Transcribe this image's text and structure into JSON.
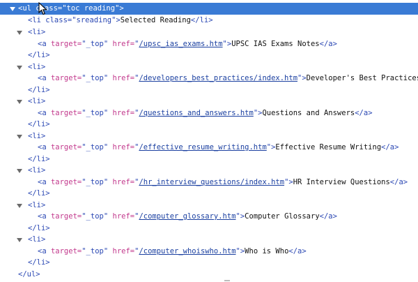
{
  "root": {
    "open": "<ul class=\"toc reading\">",
    "close": "</ul>"
  },
  "selected_reading": {
    "open": "<li class=",
    "class_value": "\"sreading\"",
    "gt": ">",
    "text": "Selected Reading",
    "close": "</li>"
  },
  "items": [
    {
      "href": "/upsc_ias_exams.htm",
      "text": "UPSC IAS Exams Notes"
    },
    {
      "href": "/developers_best_practices/index.htm",
      "text": "Developer's Best Practices"
    },
    {
      "href": "/questions_and_answers.htm",
      "text": "Questions and Answers"
    },
    {
      "href": "/effective_resume_writing.htm",
      "text": "Effective Resume Writing"
    },
    {
      "href": "/hr_interview_questions/index.htm",
      "text": "HR Interview Questions"
    },
    {
      "href": "/computer_glossary.htm",
      "text": "Computer Glossary"
    },
    {
      "href": "/computer_whoiswho.htm",
      "text": "Who is Who"
    }
  ],
  "tokens": {
    "li_open": "<li>",
    "li_close": "</li>",
    "a_open": "<a ",
    "target_attr": "target=",
    "target_val": "\"_top\"",
    "href_attr": " href=",
    "quote": "\"",
    "gt": ">",
    "a_close": "</a>"
  },
  "colors": {
    "selection": "#3a7bd5",
    "tag": "#2a47b3",
    "attribute": "#c2388c",
    "link": "#1a3fa0"
  },
  "icons": [
    "expand-triangle-icon",
    "mouse-cursor-icon"
  ]
}
